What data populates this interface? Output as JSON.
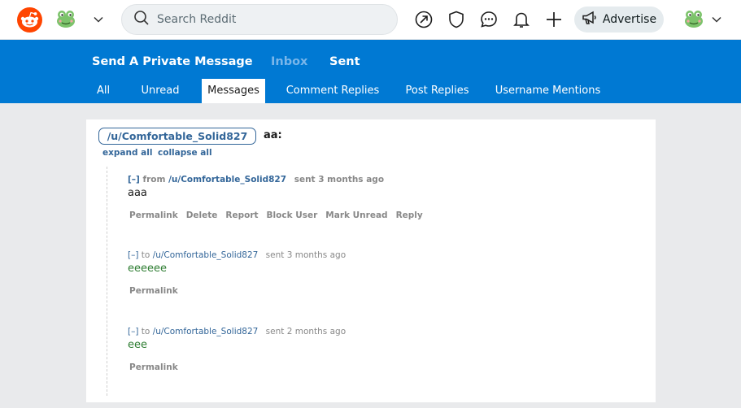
{
  "header": {
    "search_placeholder": "Search Reddit",
    "advertise_label": "Advertise",
    "icons": [
      "reddit-logo-icon",
      "frog-avatar-icon",
      "chevron-down-icon",
      "search-icon",
      "popular-icon",
      "moderation-icon",
      "chat-icon",
      "notification-icon",
      "create-post-icon",
      "megaphone-icon"
    ]
  },
  "nav": {
    "top": [
      "Send A Private Message",
      "Inbox",
      "Sent"
    ],
    "sub": [
      "All",
      "Unread",
      "Messages",
      "Comment Replies",
      "Post Replies",
      "Username Mentions"
    ]
  },
  "thread": {
    "user": "/u/Comfortable_Solid827",
    "subject": "aa:",
    "expand_all": "expand all",
    "collapse_all": "collapse all"
  },
  "messages": [
    {
      "toggle": "[–]",
      "direction": "from",
      "user": "/u/Comfortable_Solid827",
      "time": "sent 3 months ago",
      "body": "aaa",
      "actions": [
        "Permalink",
        "Delete",
        "Report",
        "Block User",
        "Mark Unread",
        "Reply"
      ]
    },
    {
      "toggle": "[–]",
      "direction": "to",
      "user": "/u/Comfortable_Solid827",
      "time": "sent 3 months ago",
      "body": "eeeeee",
      "actions": [
        "Permalink"
      ]
    },
    {
      "toggle": "[–]",
      "direction": "to",
      "user": "/u/Comfortable_Solid827",
      "time": "sent 2 months ago",
      "body": "eee",
      "actions": [
        "Permalink"
      ]
    }
  ],
  "colors": {
    "nav_blue": "#0079d3",
    "link_blue": "#336699",
    "reddit_orange": "#ff4500",
    "sent_green": "#2e7d32"
  }
}
